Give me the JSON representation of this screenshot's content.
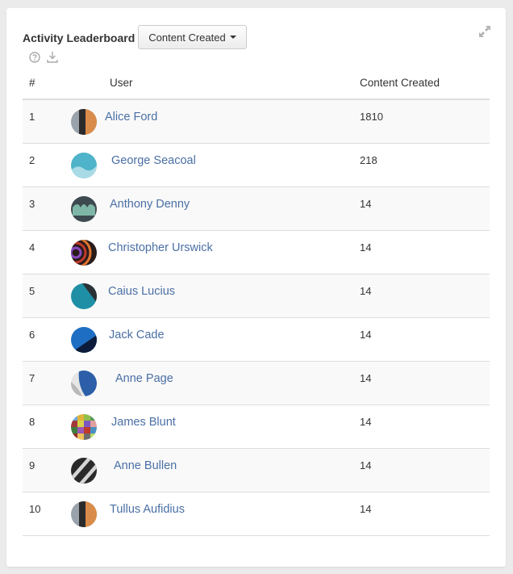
{
  "widget": {
    "title": "Activity Leaderboard",
    "metric_button_label": "Content Created",
    "icons": [
      "expand-icon",
      "help-icon",
      "download-icon"
    ]
  },
  "table": {
    "headers": {
      "rank": "#",
      "user": "User",
      "content": "Content Created"
    },
    "rows": [
      {
        "rank": "1",
        "name": "Alice Ford",
        "count": "1810"
      },
      {
        "rank": "2",
        "name": "George Seacoal",
        "count": "218"
      },
      {
        "rank": "3",
        "name": "Anthony Denny",
        "count": "14"
      },
      {
        "rank": "4",
        "name": "Christopher Urswick",
        "count": "14"
      },
      {
        "rank": "5",
        "name": "Caius Lucius",
        "count": "14"
      },
      {
        "rank": "6",
        "name": "Jack Cade",
        "count": "14"
      },
      {
        "rank": "7",
        "name": "Anne Page",
        "count": "14"
      },
      {
        "rank": "8",
        "name": "James Blunt",
        "count": "14"
      },
      {
        "rank": "9",
        "name": "Anne Bullen",
        "count": "14"
      },
      {
        "rank": "10",
        "name": "Tullus Aufidius",
        "count": "14"
      }
    ]
  },
  "colors": {
    "link": "#4a6fa5",
    "row_stripe": "#f9f9f9",
    "border": "#dddddd"
  }
}
